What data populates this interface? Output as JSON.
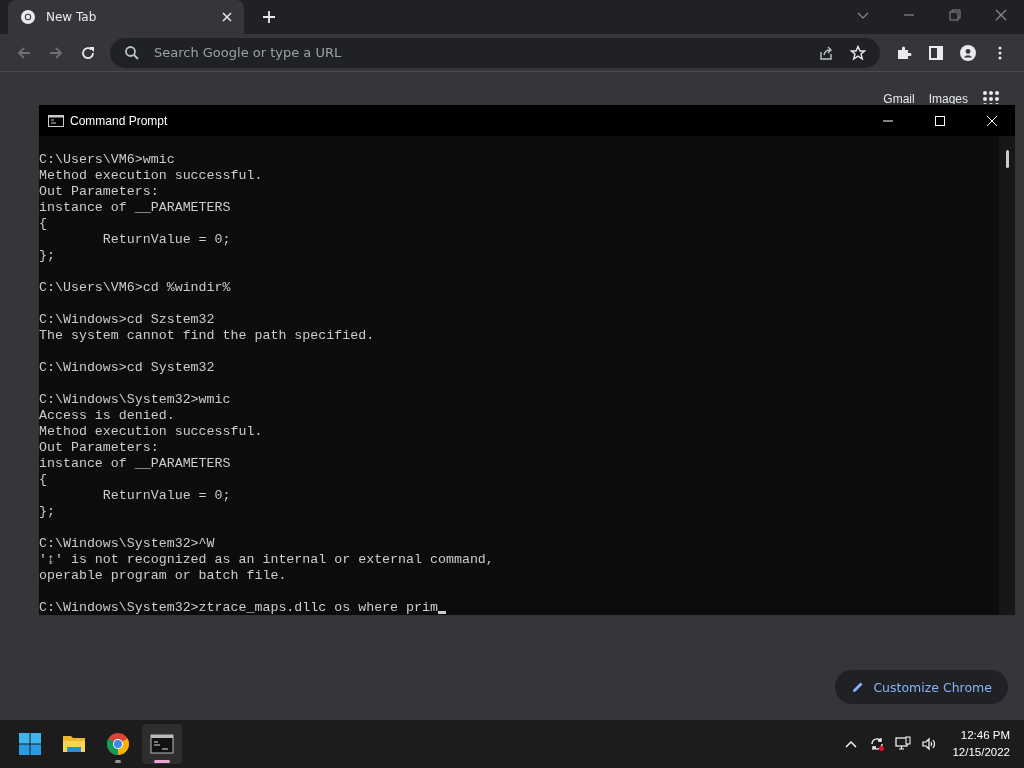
{
  "browser": {
    "tab": {
      "title": "New Tab"
    },
    "omnibox": {
      "placeholder": "Search Google or type a URL"
    },
    "top_links": [
      "Gmail",
      "Images"
    ],
    "customize_button": "Customize Chrome"
  },
  "console_window": {
    "title": "Command Prompt",
    "blocks": [
      [
        "C:\\Users\\VM6>wmic",
        "Method execution successful.",
        "Out Parameters:",
        "instance of __PARAMETERS",
        "{",
        "        ReturnValue = 0;",
        "};"
      ],
      [
        "C:\\Users\\VM6>cd %windir%"
      ],
      [
        "C:\\Windows>cd Szstem32",
        "The system cannot find the path specified."
      ],
      [
        "C:\\Windows>cd System32"
      ],
      [
        "C:\\Windows\\System32>wmic",
        "Access is denied.",
        "Method execution successful.",
        "Out Parameters:",
        "instance of __PARAMETERS",
        "{",
        "        ReturnValue = 0;",
        "};"
      ],
      [
        "C:\\Windows\\System32>^W",
        "'↨' is not recognized as an internal or external command,",
        "operable program or batch file."
      ],
      [
        "C:\\Windows\\System32>ztrace_maps.dllc os where prim"
      ]
    ]
  },
  "taskbar": {
    "apps": [
      {
        "kind": "start",
        "selected": false
      },
      {
        "kind": "explorer",
        "selected": false
      },
      {
        "kind": "chrome",
        "selected": false
      },
      {
        "kind": "terminal",
        "selected": true
      }
    ],
    "time": "12:46 PM",
    "date": "12/15/2022"
  }
}
